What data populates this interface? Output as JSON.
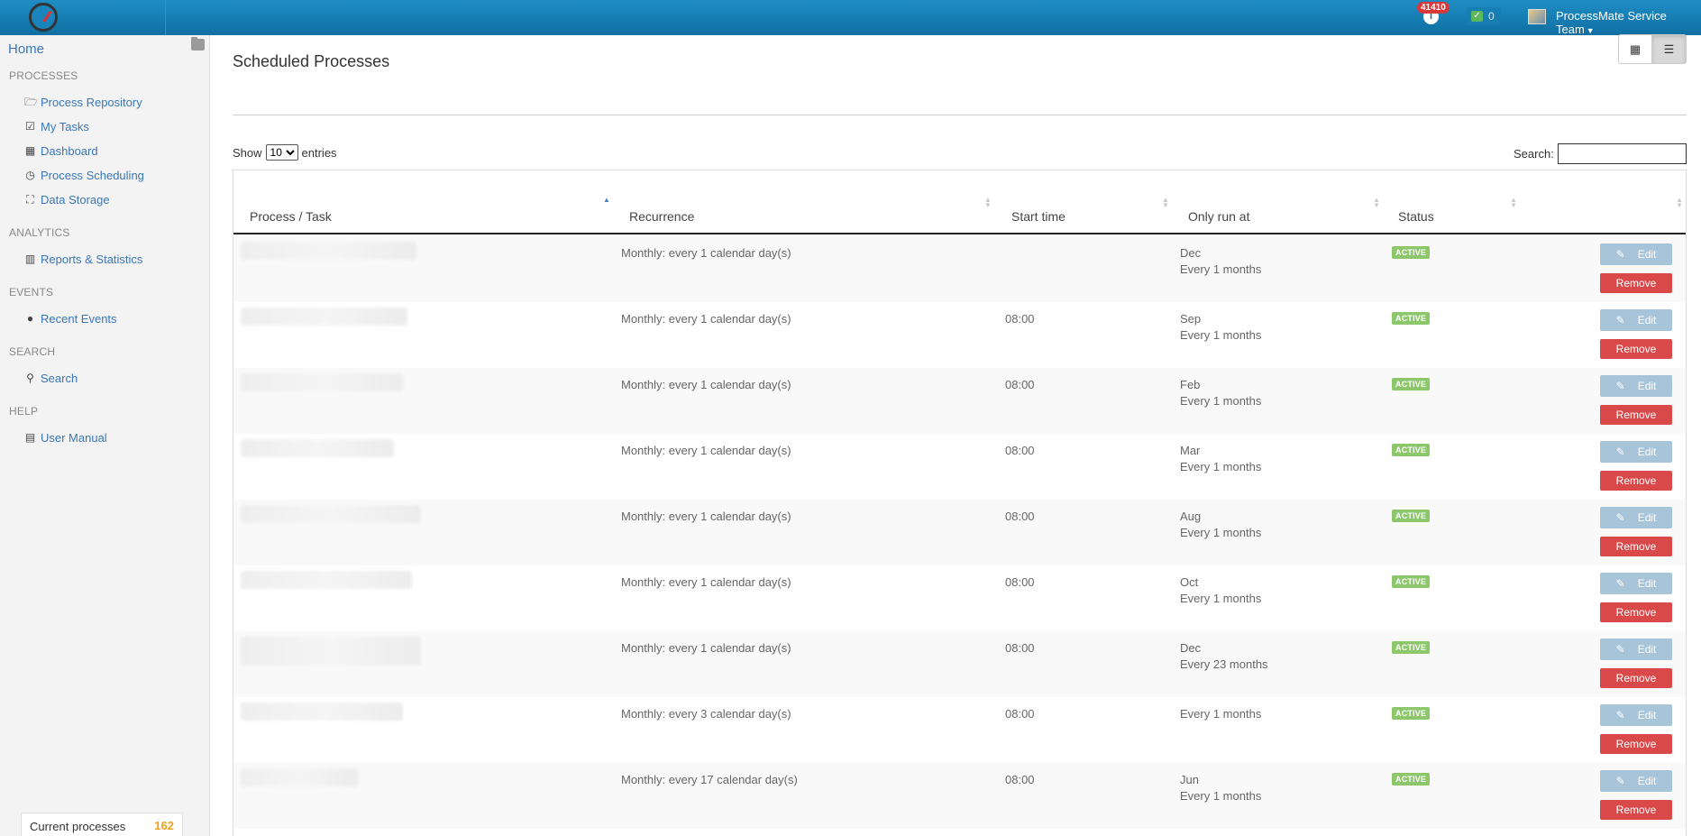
{
  "header": {
    "notifications_count": "41410",
    "notifications_icon": "info-icon",
    "tasks_count": "0",
    "user_name": "ProcessMate Service Team"
  },
  "sidebar": {
    "home": "Home",
    "sections": [
      {
        "title": "PROCESSES",
        "items": [
          {
            "label": "Process Repository",
            "icon": "folder-open-icon"
          },
          {
            "label": "My Tasks",
            "icon": "check-square-icon"
          },
          {
            "label": "Dashboard",
            "icon": "calendar-icon"
          },
          {
            "label": "Process Scheduling",
            "icon": "clock-icon"
          },
          {
            "label": "Data Storage",
            "icon": "sitemap-icon"
          }
        ]
      },
      {
        "title": "ANALYTICS",
        "items": [
          {
            "label": "Reports & Statistics",
            "icon": "bar-chart-icon"
          }
        ]
      },
      {
        "title": "EVENTS",
        "items": [
          {
            "label": "Recent Events",
            "icon": "globe-icon"
          }
        ]
      },
      {
        "title": "SEARCH",
        "items": [
          {
            "label": "Search",
            "icon": "search-icon"
          }
        ]
      },
      {
        "title": "HELP",
        "items": [
          {
            "label": "User Manual",
            "icon": "book-icon"
          }
        ]
      }
    ],
    "current_processes_label": "Current processes",
    "current_processes_count": "162"
  },
  "main": {
    "title": "Scheduled Processes",
    "show_label": "Show",
    "entries_label": "entries",
    "page_size": "10",
    "search_label": "Search:",
    "columns": [
      "Process / Task",
      "Recurrence",
      "Start time",
      "Only run at",
      "Status"
    ],
    "rows": [
      {
        "recurrence": "Monthly: every 1 calendar day(s)",
        "start": "",
        "run_at_1": "Dec",
        "run_at_2": "Every 1 months",
        "status": "ACTIVE"
      },
      {
        "recurrence": "Monthly: every 1 calendar day(s)",
        "start": "08:00",
        "run_at_1": "Sep",
        "run_at_2": "Every 1 months",
        "status": "ACTIVE"
      },
      {
        "recurrence": "Monthly: every 1 calendar day(s)",
        "start": "08:00",
        "run_at_1": "Feb",
        "run_at_2": "Every 1 months",
        "status": "ACTIVE"
      },
      {
        "recurrence": "Monthly: every 1 calendar day(s)",
        "start": "08:00",
        "run_at_1": "Mar",
        "run_at_2": "Every 1 months",
        "status": "ACTIVE"
      },
      {
        "recurrence": "Monthly: every 1 calendar day(s)",
        "start": "08:00",
        "run_at_1": "Aug",
        "run_at_2": "Every 1 months",
        "status": "ACTIVE"
      },
      {
        "recurrence": "Monthly: every 1 calendar day(s)",
        "start": "08:00",
        "run_at_1": "Oct",
        "run_at_2": "Every 1 months",
        "status": "ACTIVE"
      },
      {
        "recurrence": "Monthly: every 1 calendar day(s)",
        "start": "08:00",
        "run_at_1": "Dec",
        "run_at_2": "Every 23 months",
        "status": "ACTIVE"
      },
      {
        "recurrence": "Monthly: every 3 calendar day(s)",
        "start": "08:00",
        "run_at_1": "Every 1 months",
        "run_at_2": "",
        "status": "ACTIVE"
      },
      {
        "recurrence": "Monthly: every 17 calendar day(s)",
        "start": "08:00",
        "run_at_1": "Jun",
        "run_at_2": "Every 1 months",
        "status": "ACTIVE"
      }
    ],
    "edit_label": "Edit",
    "remove_label": "Remove"
  }
}
